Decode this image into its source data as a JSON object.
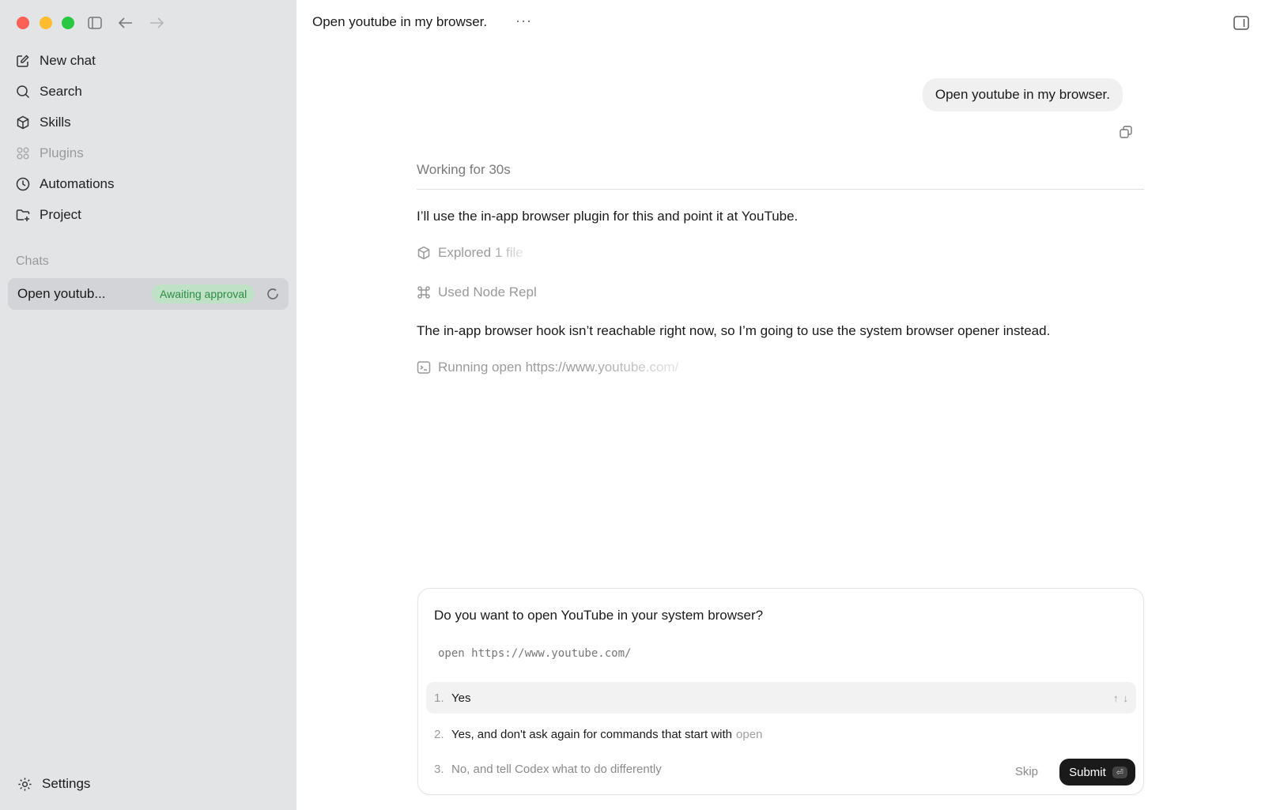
{
  "window": {
    "title": "Open youtube in my browser."
  },
  "sidebar": {
    "items": [
      {
        "label": "New chat",
        "icon": "edit-icon"
      },
      {
        "label": "Search",
        "icon": "search-icon"
      },
      {
        "label": "Skills",
        "icon": "cube-icon"
      },
      {
        "label": "Plugins",
        "icon": "grid-icon"
      },
      {
        "label": "Automations",
        "icon": "clock-icon"
      },
      {
        "label": "Project",
        "icon": "folder-plus-icon"
      }
    ],
    "chats_label": "Chats",
    "chat": {
      "title": "Open youtub...",
      "badge": "Awaiting approval"
    },
    "settings_label": "Settings"
  },
  "conversation": {
    "user_message": "Open youtube in my browser.",
    "working_label": "Working for 30s",
    "assistant_1": "I’ll use the in-app browser plugin for this and point it at YouTube.",
    "tool_1": "Explored 1 file",
    "tool_2": "Used Node Repl",
    "assistant_2": "The in-app browser hook isn’t reachable right now, so I’m going to use the system browser opener instead.",
    "tool_3": "Running open https://www.youtube.com/"
  },
  "approval": {
    "question": "Do you want to open YouTube in your system browser?",
    "command": "open https://www.youtube.com/",
    "options": [
      {
        "num": "1.",
        "label": "Yes"
      },
      {
        "num": "2.",
        "label": "Yes, and don't ask again for commands that start with",
        "extra": "open"
      },
      {
        "num": "3.",
        "label": "No, and tell Codex what to do differently"
      }
    ],
    "skip_label": "Skip",
    "submit_label": "Submit",
    "enter_key": "⏎"
  },
  "colors": {
    "badge_bg": "#bfe2c6",
    "badge_text": "#2e8b45",
    "submit_bg": "#1a1a1a"
  }
}
